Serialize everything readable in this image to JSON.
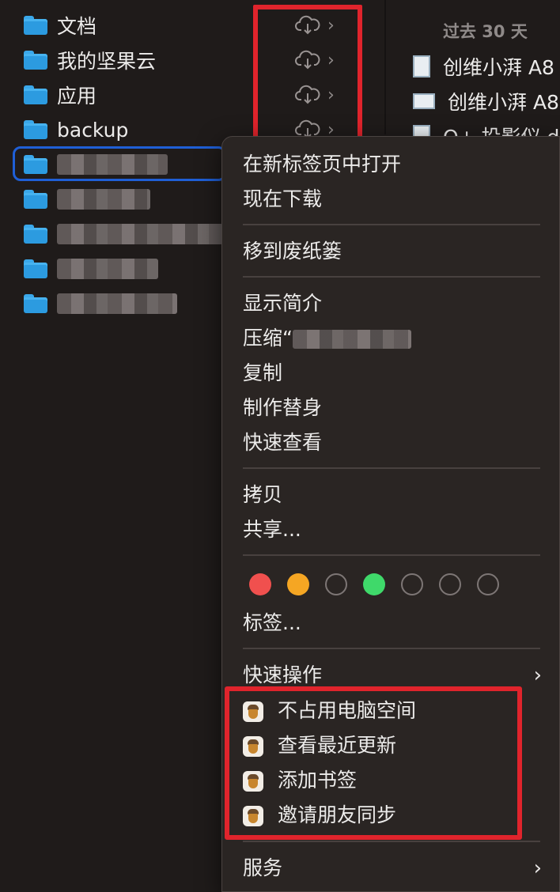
{
  "sidebar": {
    "folders": [
      {
        "name": "文档"
      },
      {
        "name": "我的坚果云"
      },
      {
        "name": "应用"
      },
      {
        "name": "backup"
      }
    ],
    "redacted_count": 5
  },
  "recent": {
    "header": "过去 30 天",
    "items": [
      {
        "name": "创维小湃 A8"
      },
      {
        "name": "创维小湃 A8"
      },
      {
        "name": "Q+ 投影仪 d"
      }
    ]
  },
  "context_menu": {
    "open_new_tab": "在新标签页中打开",
    "download_now": "现在下载",
    "move_to_trash": "移到废纸篓",
    "get_info": "显示简介",
    "compress": "压缩“",
    "duplicate": "复制",
    "make_alias": "制作替身",
    "quick_look": "快速查看",
    "copy": "拷贝",
    "share": "共享...",
    "tags_colors": [
      "#f0504e",
      "#f5a623",
      "",
      "#3fd96a",
      "",
      "",
      ""
    ],
    "tags": "标签...",
    "quick_actions": "快速操作",
    "nutstore_actions": [
      {
        "label": "不占用电脑空间",
        "icon": "acorn-icon"
      },
      {
        "label": "查看最近更新",
        "icon": "acorn-icon"
      },
      {
        "label": "添加书签",
        "icon": "acorn-icon"
      },
      {
        "label": "邀请朋友同步",
        "icon": "acorn-icon"
      }
    ],
    "services": "服务"
  },
  "colors": {
    "highlight_red": "#e0242c",
    "selection_blue": "#1f5fd6",
    "folder_blue": "#2c9be0"
  }
}
